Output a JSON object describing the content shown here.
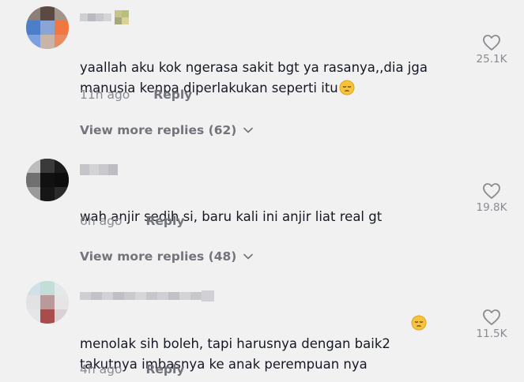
{
  "comments": [
    {
      "text": "yaallah aku kok ngerasa sakit bgt ya rasanya,,dia jga\nmanusia kenpa diperlakukan seperti itu",
      "has_emoji": true,
      "time": "11h ago",
      "reply_label": "Reply",
      "likes": "25.1K",
      "more_replies": "View more replies (62)"
    },
    {
      "text": "wah anjir sedih si, baru kali ini anjir liat real gt",
      "has_emoji": false,
      "time": "6h ago",
      "reply_label": "Reply",
      "likes": "19.8K",
      "more_replies": "View more replies (48)"
    },
    {
      "text": "menolak sih boleh, tapi harusnya dengan baik2\ntakutnya imbasnya ke anak perempuan nya",
      "has_emoji": true,
      "time": "4h ago",
      "reply_label": "Reply",
      "likes": "11.5K"
    }
  ],
  "icons": {
    "like": "heart-outline-icon",
    "expand": "chevron-down-icon",
    "emoji": "pensive-face-emoji"
  },
  "colors": {
    "background": "#f1f1f2",
    "text": "#161823",
    "secondary": "#8a8b91"
  }
}
